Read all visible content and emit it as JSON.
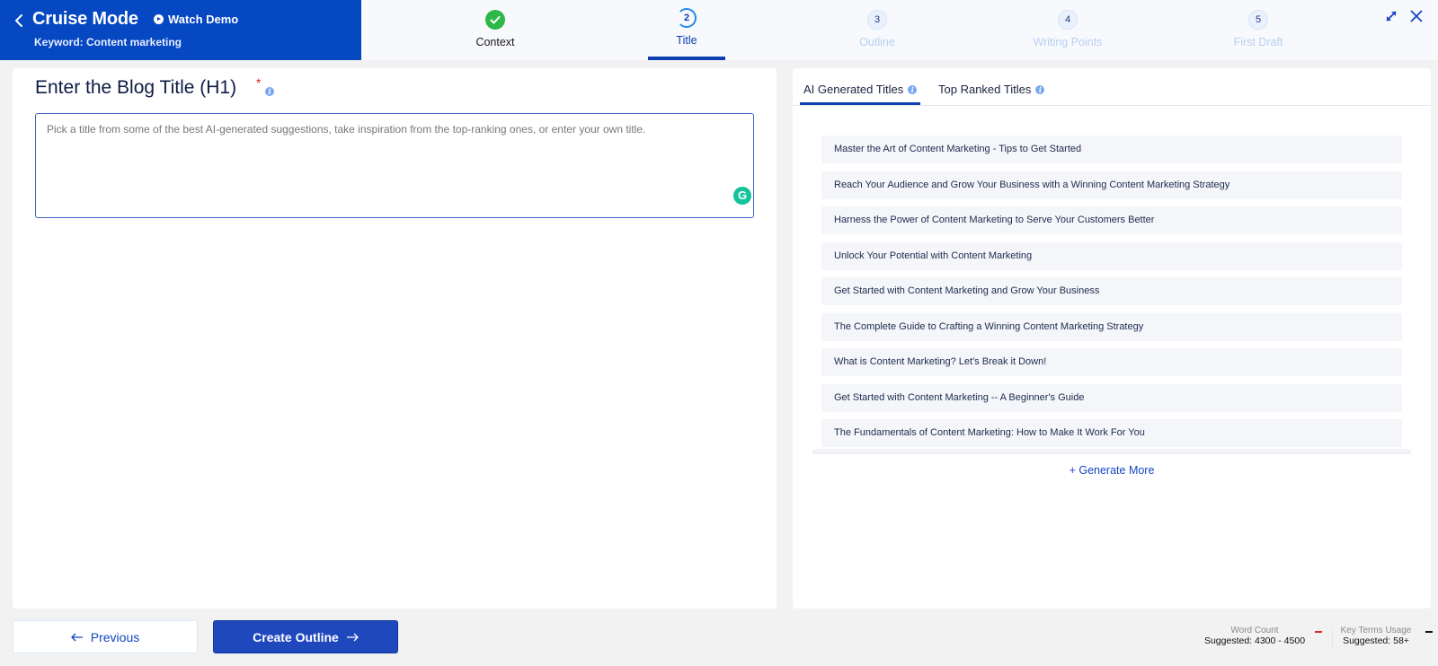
{
  "header": {
    "title": "Cruise Mode",
    "watch_demo_label": "Watch Demo",
    "keyword": "Keyword: Content marketing",
    "brand_color": "#0647c2",
    "steps": [
      {
        "number": "1",
        "label": "Context",
        "state": "done"
      },
      {
        "number": "2",
        "label": "Title",
        "state": "active"
      },
      {
        "number": "3",
        "label": "Outline",
        "state": "pending"
      },
      {
        "number": "4",
        "label": "Writing Points",
        "state": "pending"
      },
      {
        "number": "5",
        "label": "First Draft",
        "state": "pending"
      }
    ]
  },
  "left_panel": {
    "heading": "Enter the Blog Title (H1)",
    "required_marker": "*",
    "info_icon": "i",
    "input_value": "",
    "input_placeholder": "Pick a title from some of the best AI-generated suggestions, take inspiration from the top-ranking ones, or enter your own title.",
    "grammarly_glyph": "G"
  },
  "right_panel": {
    "tabs": [
      {
        "label": "AI Generated Titles",
        "active": true
      },
      {
        "label": "Top Ranked Titles",
        "active": false
      }
    ],
    "titles": [
      "Master the Art of Content Marketing - Tips to Get Started",
      "Reach Your Audience and Grow Your Business with a Winning Content Marketing Strategy",
      "Harness the Power of Content Marketing to Serve Your Customers Better",
      "Unlock Your Potential with Content Marketing",
      "Get Started with Content Marketing and Grow Your Business",
      "The Complete Guide to Crafting a Winning Content Marketing Strategy",
      "What is Content Marketing? Let's Break it Down!",
      "Get Started with Content Marketing -- A Beginner's Guide",
      "The Fundamentals of Content Marketing: How to Make It Work For You"
    ],
    "generate_more_label": "+ Generate More"
  },
  "footer": {
    "previous_label": "Previous",
    "next_label": "Create Outline",
    "word_count": {
      "label": "Word Count",
      "value": "Suggested: 4300 - 4500",
      "status": "-",
      "status_color": "#e02424"
    },
    "key_terms": {
      "label": "Key Terms Usage",
      "value": "Suggested: 58+",
      "status": "-",
      "status_color": "#111111"
    }
  }
}
